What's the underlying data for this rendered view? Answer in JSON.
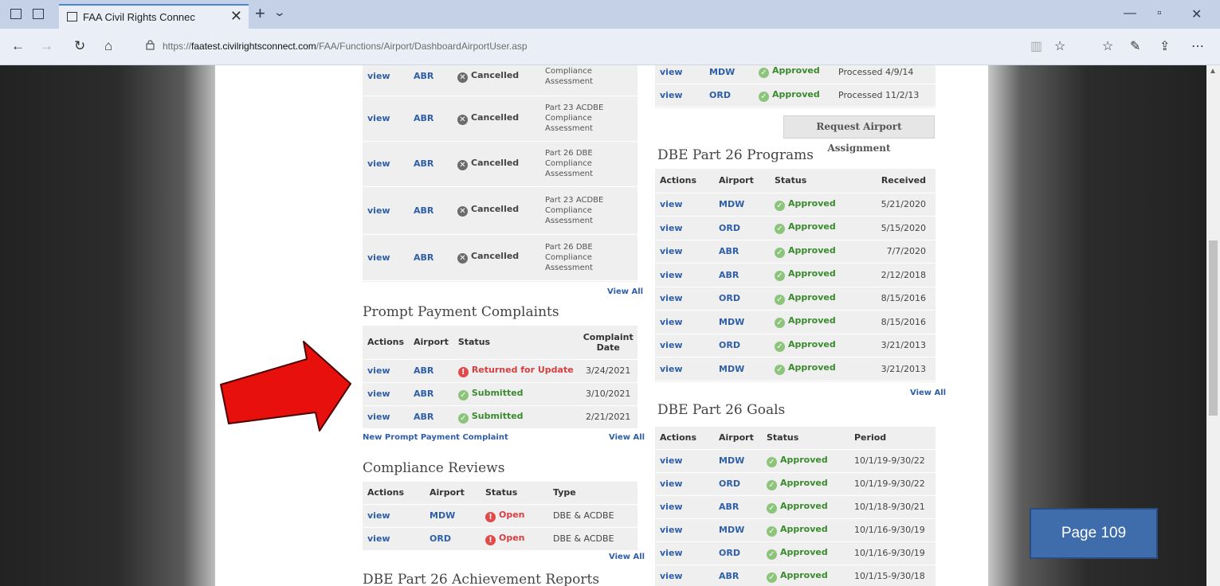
{
  "browser": {
    "tab_title": "FAA Civil Rights Connec",
    "tab_close": "✕",
    "new_tab": "+",
    "tab_dropdown": "⌄",
    "url_prefix": "https://",
    "url_domain": "faatest.civilrightsconnect.com",
    "url_path": "/FAA/Functions/Airport/DashboardAirportUser.asp",
    "more_label": "⋯"
  },
  "left_panel_top": {
    "rows": [
      {
        "action": "view",
        "airport": "ABR",
        "status": "Cancelled",
        "type_lines": [
          "Compliance",
          "Assessment"
        ]
      },
      {
        "action": "view",
        "airport": "ABR",
        "status": "Cancelled",
        "type_lines": [
          "Part 23 ACDBE",
          "Compliance",
          "Assessment"
        ]
      },
      {
        "action": "view",
        "airport": "ABR",
        "status": "Cancelled",
        "type_lines": [
          "Part 26 DBE",
          "Compliance",
          "Assessment"
        ]
      },
      {
        "action": "view",
        "airport": "ABR",
        "status": "Cancelled",
        "type_lines": [
          "Part 23 ACDBE",
          "Compliance",
          "Assessment"
        ]
      },
      {
        "action": "view",
        "airport": "ABR",
        "status": "Cancelled",
        "type_lines": [
          "Part 26 DBE",
          "Compliance",
          "Assessment"
        ]
      }
    ],
    "view_all": "View All"
  },
  "prompt_payment": {
    "title": "Prompt Payment Complaints",
    "headers": {
      "actions": "Actions",
      "airport": "Airport",
      "status": "Status",
      "date": "Complaint Date"
    },
    "rows": [
      {
        "action": "view",
        "airport": "ABR",
        "status": "Returned for Update",
        "date": "3/24/2021"
      },
      {
        "action": "view",
        "airport": "ABR",
        "status": "Submitted",
        "date": "3/10/2021"
      },
      {
        "action": "view",
        "airport": "ABR",
        "status": "Submitted",
        "date": "2/21/2021"
      }
    ],
    "new_link": "New Prompt Payment Complaint",
    "view_all": "View All"
  },
  "compliance_reviews": {
    "title": "Compliance Reviews",
    "headers": {
      "actions": "Actions",
      "airport": "Airport",
      "status": "Status",
      "type": "Type"
    },
    "rows": [
      {
        "action": "view",
        "airport": "MDW",
        "status": "Open",
        "type": "DBE & ACDBE"
      },
      {
        "action": "view",
        "airport": "ORD",
        "status": "Open",
        "type": "DBE & ACDBE"
      }
    ],
    "view_all": "View All"
  },
  "achievement_reports": {
    "title": "DBE Part 26 Achievement Reports"
  },
  "airport_assignments": {
    "rows": [
      {
        "action": "view",
        "airport": "MDW",
        "status": "Approved",
        "processed": "Processed 4/9/14"
      },
      {
        "action": "view",
        "airport": "ORD",
        "status": "Approved",
        "processed": "Processed 11/2/13"
      }
    ],
    "request_button": "Request Airport Assignment"
  },
  "dbe_programs": {
    "title": "DBE Part 26 Programs",
    "headers": {
      "actions": "Actions",
      "airport": "Airport",
      "status": "Status",
      "received": "Received"
    },
    "rows": [
      {
        "action": "view",
        "airport": "MDW",
        "status": "Approved",
        "received": "5/21/2020"
      },
      {
        "action": "view",
        "airport": "ORD",
        "status": "Approved",
        "received": "5/15/2020"
      },
      {
        "action": "view",
        "airport": "ABR",
        "status": "Approved",
        "received": "7/7/2020"
      },
      {
        "action": "view",
        "airport": "ABR",
        "status": "Approved",
        "received": "2/12/2018"
      },
      {
        "action": "view",
        "airport": "ORD",
        "status": "Approved",
        "received": "8/15/2016"
      },
      {
        "action": "view",
        "airport": "MDW",
        "status": "Approved",
        "received": "8/15/2016"
      },
      {
        "action": "view",
        "airport": "ORD",
        "status": "Approved",
        "received": "3/21/2013"
      },
      {
        "action": "view",
        "airport": "MDW",
        "status": "Approved",
        "received": "3/21/2013"
      }
    ],
    "view_all": "View All"
  },
  "dbe_goals": {
    "title": "DBE Part 26 Goals",
    "headers": {
      "actions": "Actions",
      "airport": "Airport",
      "status": "Status",
      "period": "Period"
    },
    "rows": [
      {
        "action": "view",
        "airport": "MDW",
        "status": "Approved",
        "period": "10/1/19-9/30/22"
      },
      {
        "action": "view",
        "airport": "ORD",
        "status": "Approved",
        "period": "10/1/19-9/30/22"
      },
      {
        "action": "view",
        "airport": "ABR",
        "status": "Approved",
        "period": "10/1/18-9/30/21"
      },
      {
        "action": "view",
        "airport": "MDW",
        "status": "Approved",
        "period": "10/1/16-9/30/19"
      },
      {
        "action": "view",
        "airport": "ORD",
        "status": "Approved",
        "period": "10/1/16-9/30/19"
      },
      {
        "action": "view",
        "airport": "ABR",
        "status": "Approved",
        "period": "10/1/15-9/30/18"
      }
    ]
  },
  "annotation": {
    "page_label": "Page 109",
    "arrow_color": "#e8100c",
    "badge_color": "#3f6dab"
  }
}
